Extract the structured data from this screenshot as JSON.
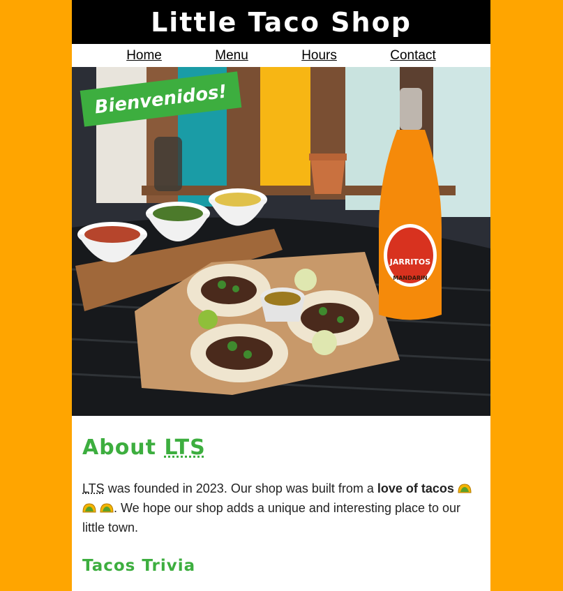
{
  "header": {
    "title": "Little Taco Shop"
  },
  "nav": {
    "items": [
      {
        "label": "Home"
      },
      {
        "label": "Menu"
      },
      {
        "label": "Hours"
      },
      {
        "label": "Contact"
      }
    ]
  },
  "hero": {
    "banner": "Bienvenidos!",
    "bottle_brand": "JARRITOS",
    "bottle_flavor": "MANDARIN"
  },
  "about": {
    "title_prefix": "About",
    "title_abbr": "LTS",
    "p_abbr": "LTS",
    "p_part1": " was founded in 2023. Our shop was built from a ",
    "p_bold": "love of tacos",
    "p_part2": ". We hope our shop adds a unique and interesting place to our little town."
  },
  "trivia": {
    "title": "Tacos Trivia"
  },
  "colors": {
    "background": "#FFA500",
    "accent_green": "#3DAE3F",
    "header_bg": "#000000"
  }
}
